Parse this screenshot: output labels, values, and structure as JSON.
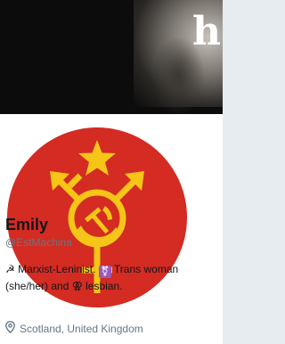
{
  "banner": {
    "letter": "h"
  },
  "profile": {
    "name": "Emily",
    "handle": "@EstMachina",
    "bio": {
      "sickle_symbol": "☭",
      "part1": " Marxist-Leninist. ",
      "trans_symbol": "⚧",
      "part2": " Trans woman (she/her) and ",
      "lesbian_symbol": "⚢",
      "part3": " lesbian."
    },
    "location": "Scotland, United Kingdom"
  },
  "colors": {
    "avatar_background": "#d42b22",
    "emblem": "#f5c518",
    "name": "#14171a",
    "secondary_text": "#657786"
  },
  "icons": {
    "avatar": "red-star-trans-symbol-hammer-sickle",
    "location": "map-pin-icon"
  }
}
